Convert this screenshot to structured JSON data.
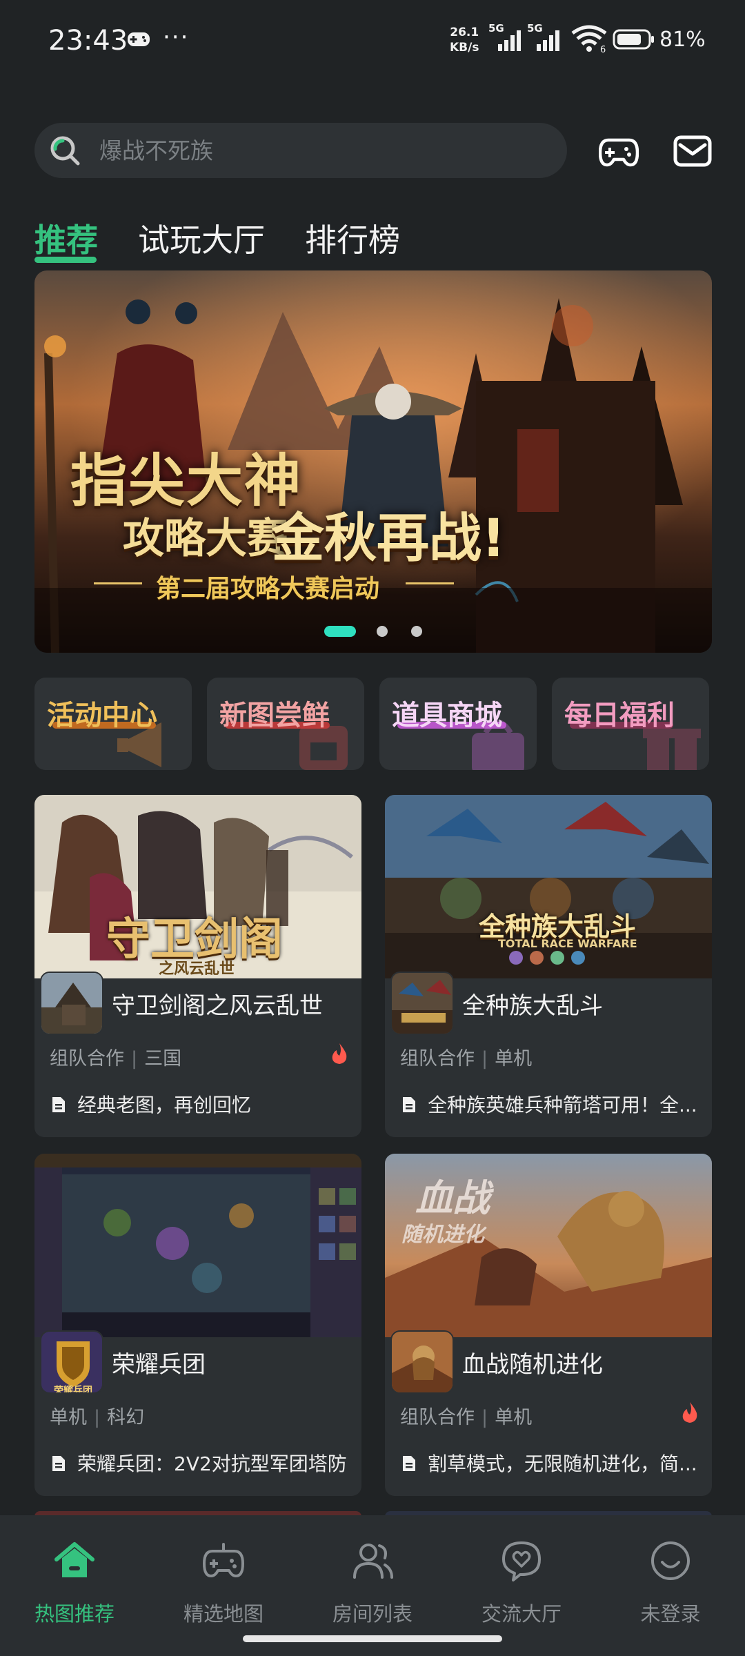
{
  "status_bar": {
    "time": "23:43",
    "net_speed_value": "26.1",
    "net_speed_unit": "KB/s",
    "sim1": "5G",
    "sim2": "5G",
    "wifi_badge": "6",
    "battery_percent": "81%",
    "battery_level": 0.81
  },
  "search": {
    "placeholder": "爆战不死族"
  },
  "tabs": [
    {
      "label": "推荐",
      "active": true
    },
    {
      "label": "试玩大厅",
      "active": false
    },
    {
      "label": "排行榜",
      "active": false
    }
  ],
  "banner": {
    "title_line1": "指尖大神",
    "title_line2a": "攻略大赛",
    "title_line2b": "金秋再战!",
    "subtitle": "第二届攻略大赛启动",
    "pages": 3,
    "active_page": 1
  },
  "categories": [
    {
      "label": "活动中心",
      "color": "#f0c05a",
      "stroke": "#d2701e"
    },
    {
      "label": "新图尝鲜",
      "color": "#f2a3a3",
      "stroke": "#c83a3a"
    },
    {
      "label": "道具商城",
      "color": "#f6d6f6",
      "stroke": "#c85ad8"
    },
    {
      "label": "每日福利",
      "color": "#f29cc0",
      "stroke": "#8a3354"
    }
  ],
  "games": [
    {
      "title": "守卫剑阁之风云乱世",
      "tag1": "组队合作",
      "tag2": "三国",
      "hot": true,
      "desc": "经典老图，再创回忆",
      "cover_text": "守卫剑阁",
      "cover_sub": "之风云乱世"
    },
    {
      "title": "全种族大乱斗",
      "tag1": "组队合作",
      "tag2": "单机",
      "hot": false,
      "desc": "全种族英雄兵种箭塔可用！全...",
      "cover_text": "全种族大乱斗",
      "cover_sub": "TOTAL RACE WARFARE"
    },
    {
      "title": "荣耀兵团",
      "tag1": "单机",
      "tag2": "科幻",
      "hot": false,
      "desc": "荣耀兵团：2V2对抗型军团塔防",
      "cover_text": "",
      "icon_text": "荣耀兵团"
    },
    {
      "title": "血战随机进化",
      "tag1": "组队合作",
      "tag2": "单机",
      "hot": true,
      "desc": "割草模式，无限随机进化，简...",
      "cover_text": "血战",
      "cover_sub": "随机进化"
    }
  ],
  "bottom_nav": [
    {
      "label": "热图推荐",
      "icon": "home-icon",
      "active": true
    },
    {
      "label": "精选地图",
      "icon": "gamepad-icon",
      "active": false
    },
    {
      "label": "房间列表",
      "icon": "users-icon",
      "active": false
    },
    {
      "label": "交流大厅",
      "icon": "chat-heart-icon",
      "active": false
    },
    {
      "label": "未登录",
      "icon": "smile-icon",
      "active": false
    }
  ],
  "colors": {
    "accent": "#35c27f",
    "background": "#202325",
    "card": "#2c3033",
    "hot": "#ff5a4e",
    "indicator": "#2fe0c0"
  }
}
